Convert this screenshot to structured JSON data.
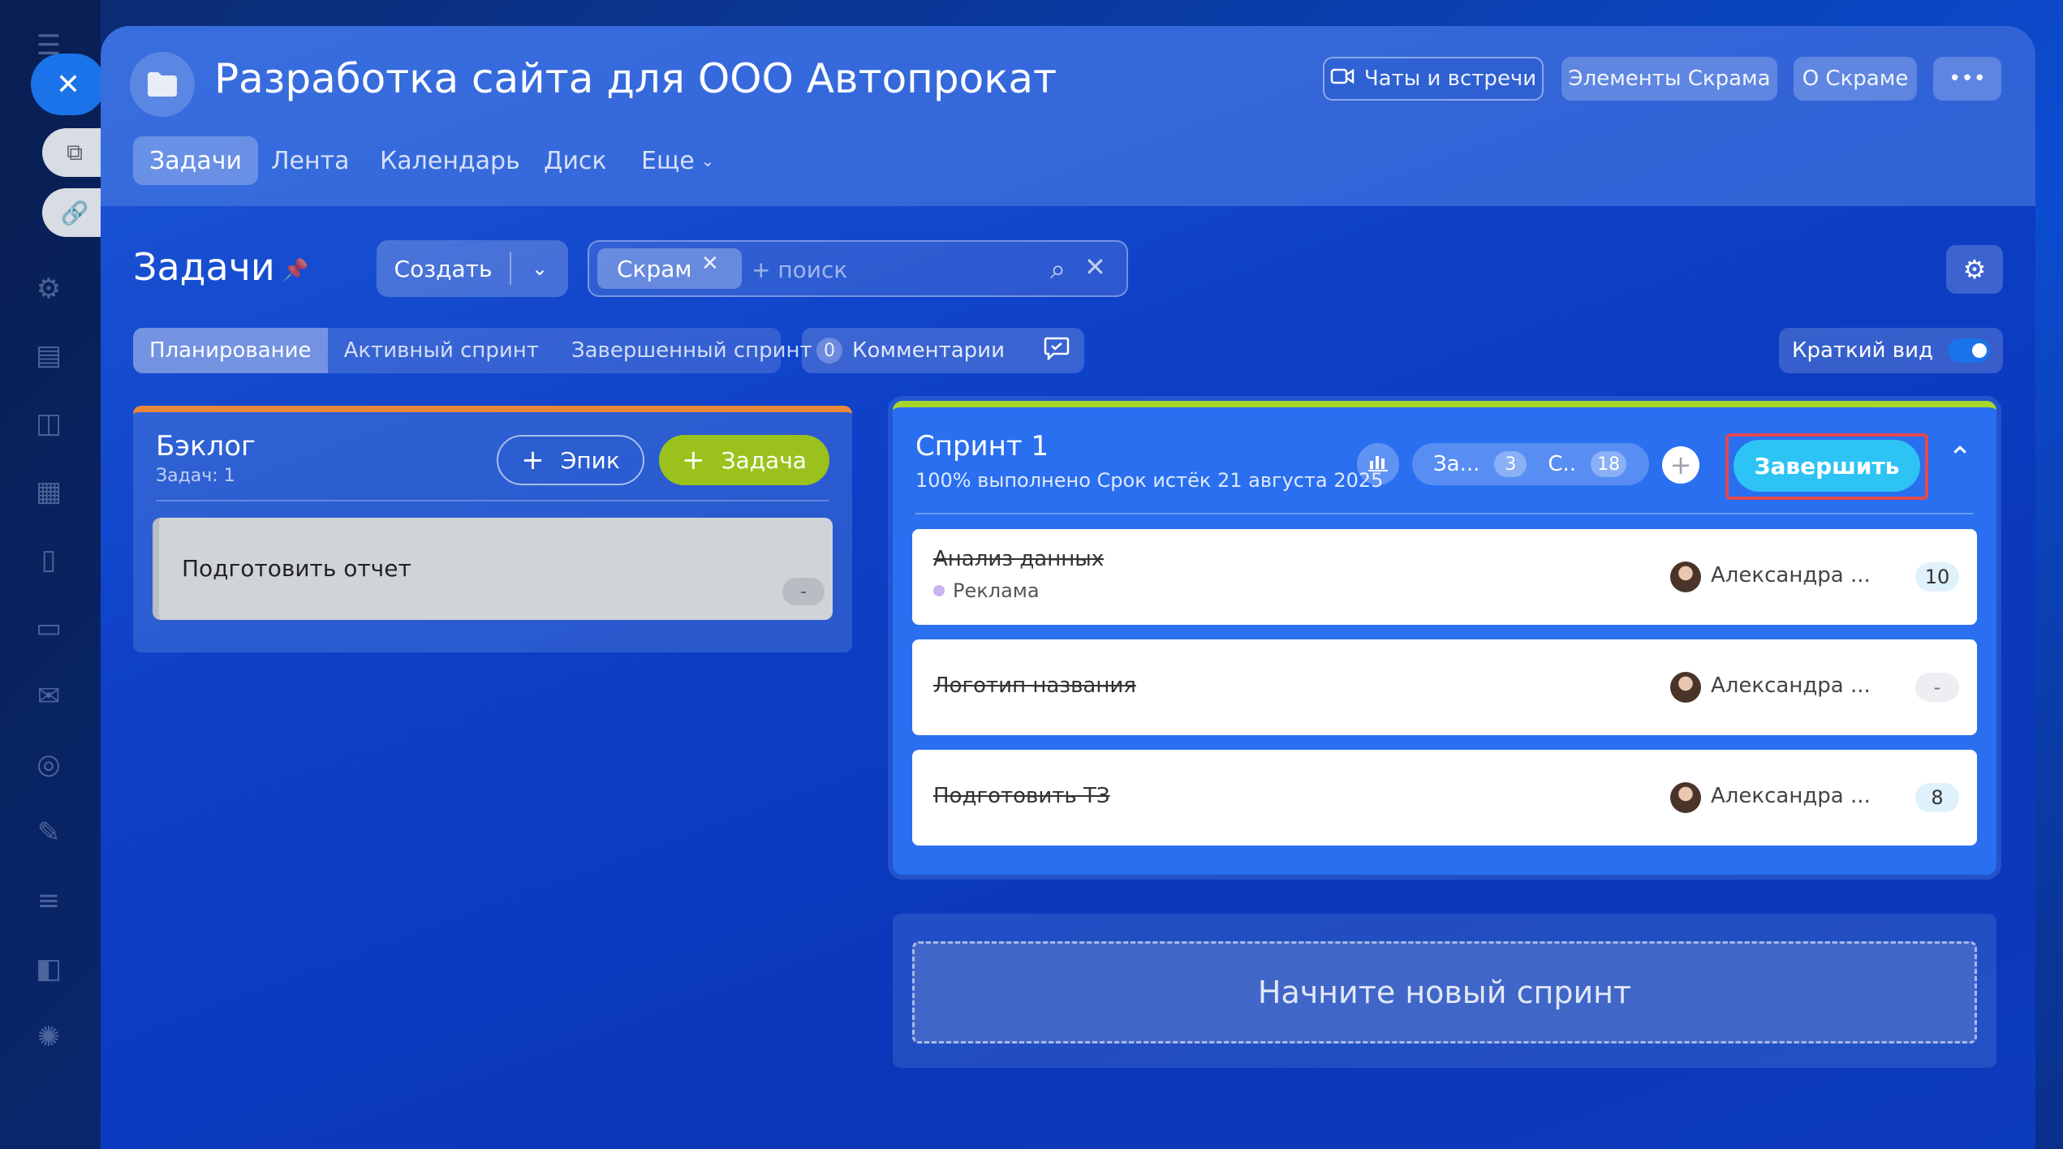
{
  "colors": {
    "accent": "#1a73e8",
    "finish_button": "#2ec3f5",
    "task_button": "#9bc21c",
    "sprint_bar": "#a6d62a",
    "backlog_bar": "#e8883a",
    "highlight_frame": "#e5484d",
    "tag_dot": "#c7b4f0"
  },
  "project": {
    "title": "Разработка сайта для ООО Автопрокат"
  },
  "header_buttons": {
    "chats": "Чаты и встречи",
    "scrum_elements": "Элементы Скрама",
    "about_scrum": "О Скраме",
    "more": "•••"
  },
  "nav": {
    "tabs": [
      {
        "label": "Задачи",
        "active": true
      },
      {
        "label": "Лента"
      },
      {
        "label": "Календарь"
      },
      {
        "label": "Диск"
      },
      {
        "label": "Еще"
      }
    ]
  },
  "toolbar": {
    "section_title": "Задачи",
    "create_label": "Создать",
    "filter_chip": "Скрам",
    "search_placeholder": "+ поиск"
  },
  "view_tabs": [
    {
      "label": "Планирование",
      "active": true
    },
    {
      "label": "Активный спринт"
    },
    {
      "label": "Завершенный спринт"
    }
  ],
  "comments": {
    "count": "0",
    "label": "Комментарии"
  },
  "brief_view": {
    "label": "Краткий вид",
    "enabled": true
  },
  "backlog": {
    "title": "Бэклог",
    "subtitle": "Задач: 1",
    "epic_button": "Эпик",
    "task_button": "Задача",
    "items": [
      {
        "name": "Подготовить отчет",
        "points": "-"
      }
    ]
  },
  "sprint": {
    "title": "Спринт 1",
    "subtitle": "100% выполнено Срок истёк 21 августа 2025",
    "stat_tasks_label": "За...",
    "stat_tasks_value": "3",
    "stat_points_label": "С..",
    "stat_points_value": "18",
    "finish_button": "Завершить",
    "tasks": [
      {
        "name": "Анализ данных",
        "tag": "Реклама",
        "assignee": "Александра ...",
        "points": "10"
      },
      {
        "name": "Логотип названия",
        "assignee": "Александра ...",
        "points": "-"
      },
      {
        "name": "Подготовить ТЗ",
        "assignee": "Александра ...",
        "points": "8"
      }
    ]
  },
  "new_sprint": {
    "label": "Начните новый спринт"
  }
}
